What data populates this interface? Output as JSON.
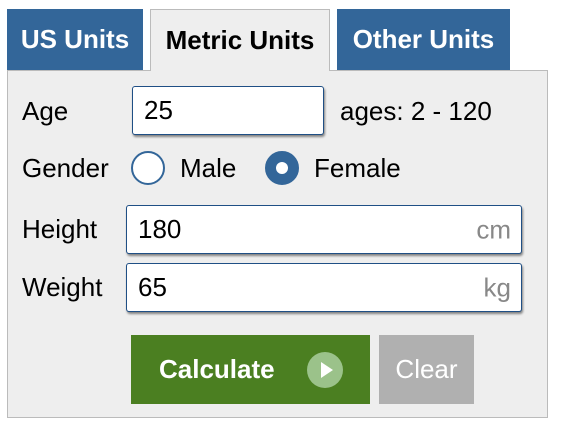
{
  "tabs": [
    {
      "label": "US Units",
      "active": false
    },
    {
      "label": "Metric Units",
      "active": true
    },
    {
      "label": "Other Units",
      "active": false
    }
  ],
  "form": {
    "age": {
      "label": "Age",
      "value": "25",
      "hint": "ages: 2 - 120"
    },
    "gender": {
      "label": "Gender",
      "options": [
        {
          "label": "Male",
          "checked": false
        },
        {
          "label": "Female",
          "checked": true
        }
      ]
    },
    "height": {
      "label": "Height",
      "value": "180",
      "unit": "cm"
    },
    "weight": {
      "label": "Weight",
      "value": "65",
      "unit": "kg"
    }
  },
  "buttons": {
    "calculate": {
      "label": "Calculate",
      "icon": "play-circle-icon"
    },
    "clear": {
      "label": "Clear"
    }
  },
  "colors": {
    "tab_inactive": "#336699",
    "panel_bg": "#eeeeee",
    "calculate_bg": "#4b7f21",
    "clear_bg": "#b0b0b0",
    "unit_text": "#888888"
  }
}
